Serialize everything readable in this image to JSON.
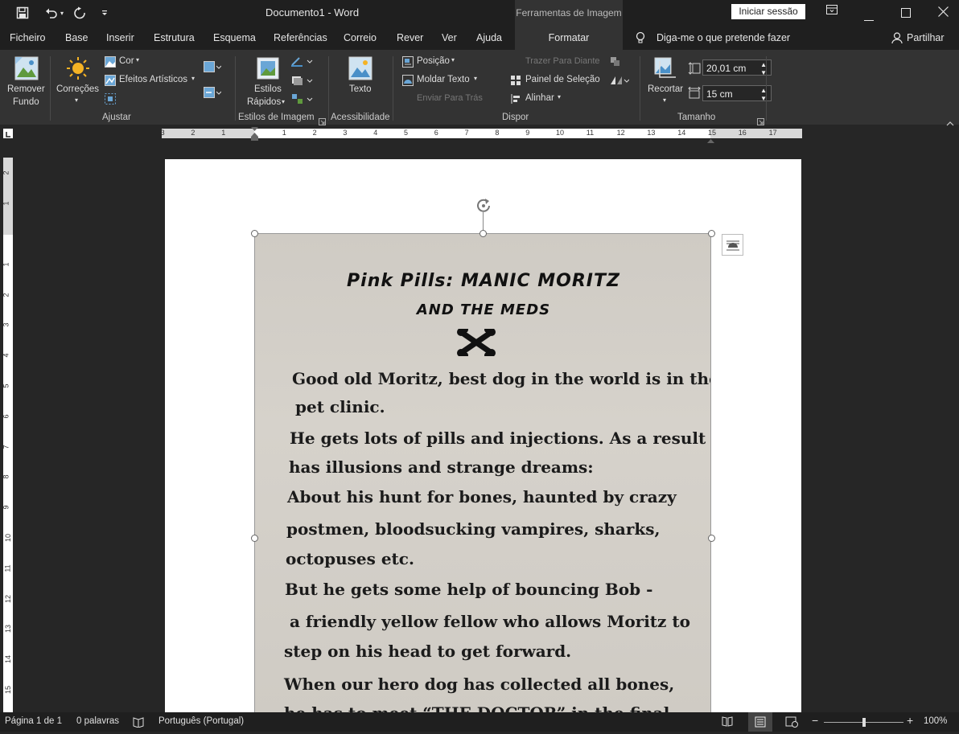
{
  "titlebar": {
    "title": "Documento1  -  Word",
    "contextual_group": "Ferramentas de Imagem",
    "signin_label": "Iniciar sessão",
    "qat": [
      "save-icon",
      "undo-icon",
      "redo-icon",
      "customize-icon"
    ]
  },
  "menu": {
    "tabs": [
      "Ficheiro",
      "Base",
      "Inserir",
      "Estrutura",
      "Esquema",
      "Referências",
      "Correio",
      "Rever",
      "Ver",
      "Ajuda"
    ],
    "active_tab": "Formatar",
    "tellme": "Diga-me o que pretende fazer",
    "share": "Partilhar"
  },
  "ribbon": {
    "remove_bg": [
      "Remover",
      "Fundo"
    ],
    "corrections": "Correções",
    "color": "Cor",
    "artistic": "Efeitos Artísticos",
    "adjust_group": "Ajustar",
    "quick_styles": [
      "Estilos",
      "Rápidos"
    ],
    "styles_group": "Estilos de Imagem",
    "alt_text": "Texto",
    "accessibility_group": "Acessibilidade",
    "position": "Posição",
    "wrap_text": "Moldar Texto",
    "bring_forward": "Trazer Para Diante",
    "send_backward": "Enviar Para Trás",
    "selection_pane": "Painel de Seleção",
    "align": "Alinhar",
    "arrange_group": "Dispor",
    "crop": "Recortar",
    "height": "20,01 cm",
    "width": "15 cm",
    "size_group": "Tamanho"
  },
  "ruler": {
    "horizontal": [
      "3",
      "2",
      "1",
      "1",
      "2",
      "3",
      "4",
      "5",
      "6",
      "7",
      "8",
      "9",
      "10",
      "11",
      "12",
      "13",
      "14",
      "15",
      "16",
      "17"
    ],
    "vertical": [
      "2",
      "1",
      "1",
      "2",
      "3",
      "4",
      "5",
      "6",
      "7",
      "8",
      "9",
      "10",
      "11",
      "12",
      "13",
      "14",
      "15"
    ]
  },
  "document": {
    "image": {
      "title_line1": "Pink Pills: MANIC MORITZ",
      "title_line2": "AND THE MEDS",
      "lines": [
        "Good old Moritz, best dog in the world is in the",
        "pet clinic.",
        "He gets lots of pills and injections. As a result he",
        "has illusions and strange dreams:",
        "About his hunt for bones, haunted by crazy",
        "postmen, bloodsucking vampires, sharks,",
        "octopuses etc.",
        "But he gets some help of bouncing Bob -",
        "a friendly yellow fellow who allows Moritz to",
        "step on his head to get forward.",
        "When our hero dog has collected all bones,",
        "he has to meet “THE DOCTOR” in the final"
      ]
    }
  },
  "status": {
    "page": "Página 1 de 1",
    "words": "0 palavras",
    "language": "Português (Portugal)",
    "zoom": "100%",
    "zoom_level": 1.0
  },
  "colors": {
    "chrome_dark": "#1f1f1f",
    "ribbon": "#333333",
    "canvas": "#262626",
    "page": "#ffffff"
  }
}
